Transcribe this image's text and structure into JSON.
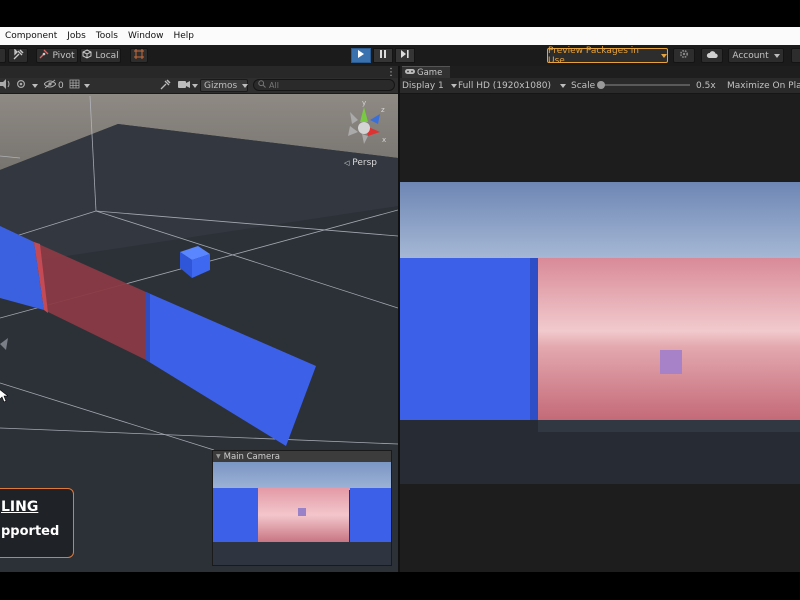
{
  "menu": {
    "items": [
      "Component",
      "Jobs",
      "Tools",
      "Window",
      "Help"
    ]
  },
  "toolbar": {
    "pivot_label": "Pivot",
    "local_label": "Local",
    "preview_packages_label": "Preview Packages in Use",
    "account_label": "Account",
    "accent_color": "#e6a33c",
    "play_active_color": "#3a72b0"
  },
  "scene": {
    "visibility_count": "0",
    "gizmos_label": "Gizmos",
    "search_placeholder": "All",
    "perspective_label": "Persp",
    "gizmo_axes": {
      "x": "x",
      "y": "y",
      "z": "z"
    },
    "camera_preview_title": "Main Camera"
  },
  "game": {
    "tab_label": "Game",
    "display_label": "Display 1",
    "resolution_label": "Full HD (1920x1080)",
    "scale_label": "Scale",
    "scale_value": "0.5x",
    "maximize_label": "Maximize On Play"
  },
  "notice": {
    "line1": "LING",
    "line2": "pported",
    "border_color": "#e07a3a"
  }
}
